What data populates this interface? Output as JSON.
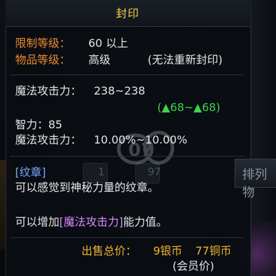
{
  "tooltip": {
    "title": "封印",
    "level_limit_label": "限制等级：",
    "level_limit_value": "60 以上",
    "item_grade_label": "物品等级：",
    "item_grade_value": "高级",
    "seal_note": "(无法重新封印)",
    "magic_attack_label": "魔法攻击力：",
    "magic_attack_value": "238~238",
    "magic_attack_bonus": "(▲68~▲68)",
    "intelligence_line": "智力：85",
    "magic_attack_pct_label": "魔法攻击力：",
    "magic_attack_pct_value": "10.00%~10.00%",
    "category": "[纹章]",
    "description": "可以感觉到神秘力量的纹章。",
    "effect_prefix": "可以增加",
    "effect_highlight": "[魔法攻击力]",
    "effect_suffix": "能力值。",
    "price_label": "出售总价：",
    "price_silver": "9银币",
    "price_copper": "77铜币",
    "member_price": "(会员价)"
  },
  "background": {
    "slot_num_1": "1",
    "slot_num_2": "97",
    "tab_label": "排列物"
  },
  "watermark": {
    "text": "07"
  },
  "colors": {
    "title": "#f2d34a",
    "label_orange": "#e98a2d",
    "value_white": "#e6e6e6",
    "bonus_green": "#3fd24a",
    "category_blue": "#7aa7ff",
    "highlight_pink": "#d88cff",
    "price_gold": "#f0b431"
  }
}
